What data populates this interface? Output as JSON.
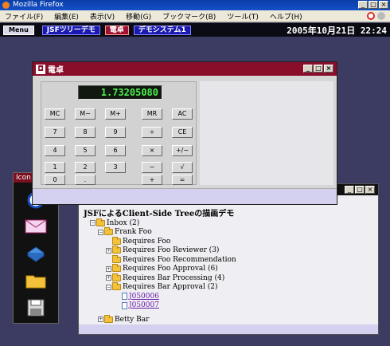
{
  "browser": {
    "title": "Mozilla Firefox",
    "menu": [
      "ファイル(F)",
      "編集(E)",
      "表示(V)",
      "移動(G)",
      "ブックマーク(B)",
      "ツール(T)",
      "ヘルプ(H)"
    ],
    "window_buttons": [
      "_",
      "□",
      "×"
    ]
  },
  "taskbar": {
    "menu_label": "Menu",
    "tasks": [
      "JSFツリーデモ",
      "電卓",
      "デモシステム1"
    ],
    "clock": "2005年10月21日 22:24"
  },
  "icons_window": {
    "title": "Icon"
  },
  "calculator": {
    "title": "電卓",
    "display": "1.73205080",
    "keys": [
      [
        "MC",
        "M−",
        "M+",
        "MR",
        "AC"
      ],
      [
        "7",
        "8",
        "9",
        "÷",
        "CE"
      ],
      [
        "4",
        "5",
        "6",
        "×",
        "+/−"
      ],
      [
        "1",
        "2",
        "3",
        "−",
        "√"
      ],
      [
        "0",
        ".",
        "+",
        "="
      ]
    ]
  },
  "tree_window": {
    "heading": "JSFによるClient-Side Treeの描画デモ",
    "nodes": [
      "Inbox (2)",
      "Frank Foo",
      "Requires Foo",
      "Requires Foo Reviewer (3)",
      "Requires Foo Recommendation",
      "Requires Foo Approval (6)",
      "Requires Bar Processing (4)",
      "Requires Bar Approval (2)",
      "J050006",
      "J050007",
      "Betty Bar"
    ]
  }
}
